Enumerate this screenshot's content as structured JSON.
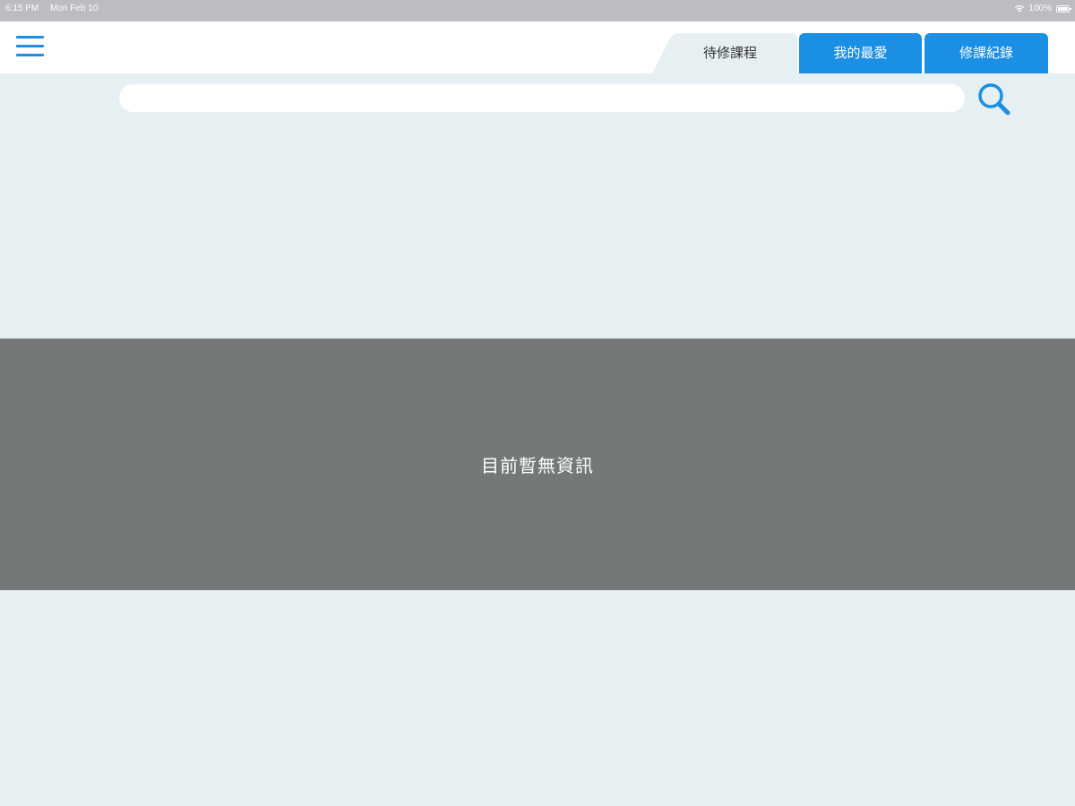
{
  "status_bar": {
    "time": "6:15 PM",
    "date": "Mon Feb 10",
    "battery": "100%"
  },
  "header": {
    "menu_icon": "hamburger-menu-icon",
    "tabs": [
      {
        "label": "待修課程",
        "active": true
      },
      {
        "label": "我的最愛",
        "active": false
      },
      {
        "label": "修課紀錄",
        "active": false
      }
    ]
  },
  "search": {
    "value": "",
    "icon": "search-icon"
  },
  "empty_state": {
    "message": "目前暫無資訊"
  },
  "colors": {
    "accent": "#1a8fe3",
    "background": "#e6f0f3",
    "overlay": "#747878",
    "status_bar": "#bcbcc1"
  }
}
